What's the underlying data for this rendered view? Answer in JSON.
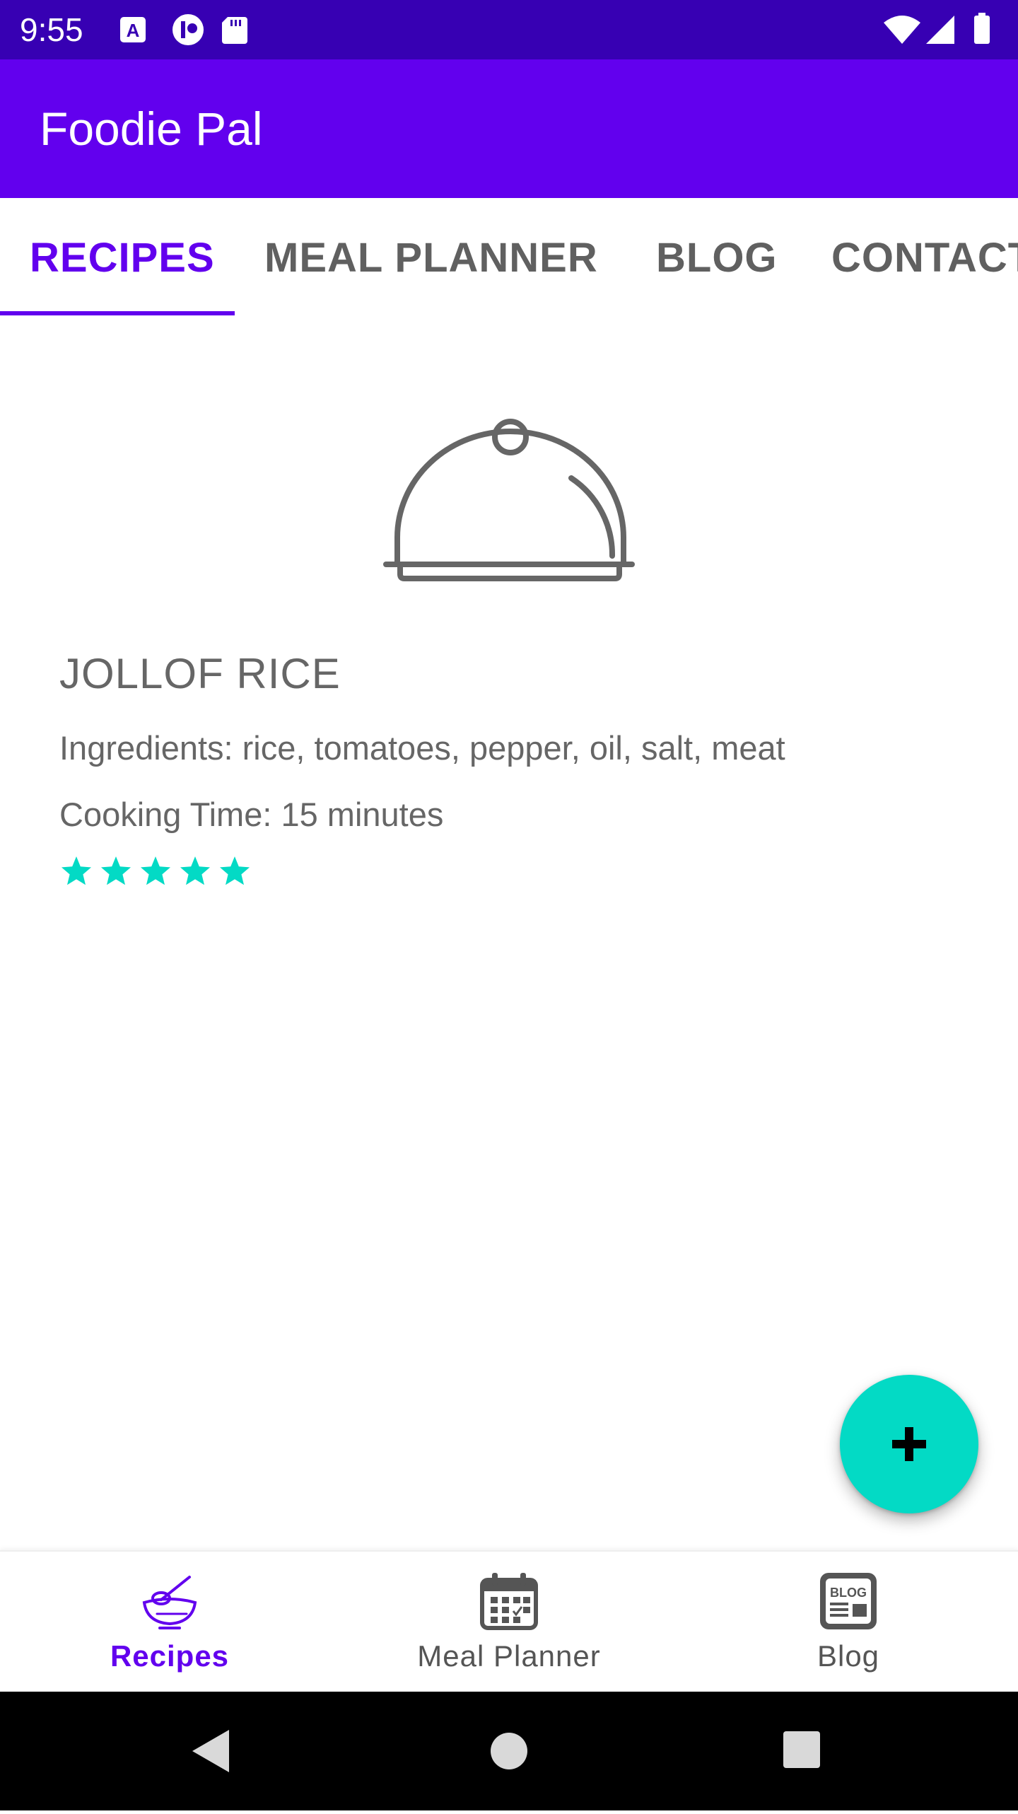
{
  "status_bar": {
    "time": "9:55",
    "left_icons": [
      "a-notification-icon",
      "app-notification-icon",
      "sd-card-icon"
    ],
    "right_icons": [
      "wifi-icon",
      "signal-icon",
      "battery-icon"
    ]
  },
  "app_bar": {
    "title": "Foodie Pal",
    "color": "#6200ee"
  },
  "tabs": [
    {
      "label": "RECIPES",
      "active": true
    },
    {
      "label": "MEAL PLANNER",
      "active": false
    },
    {
      "label": "BLOG",
      "active": false
    },
    {
      "label": "CONTACT",
      "active": false
    }
  ],
  "recipe": {
    "image_icon": "food-cloche-icon",
    "title": "JOLLOF RICE",
    "ingredients": "Ingredients: rice, tomatoes, pepper, oil, salt, meat",
    "cooking_time": "Cooking Time: 15 minutes",
    "rating": 5,
    "rating_max": 5,
    "star_color": "#03dac5"
  },
  "fab": {
    "icon": "plus-icon",
    "color": "#03dac5"
  },
  "bottom_nav": [
    {
      "label": "Recipes",
      "icon": "mixing-bowl-icon",
      "active": true
    },
    {
      "label": "Meal Planner",
      "icon": "calendar-icon",
      "active": false
    },
    {
      "label": "Blog",
      "icon": "blog-icon",
      "active": false
    }
  ],
  "system_nav": [
    "back-icon",
    "home-icon",
    "recents-icon"
  ]
}
